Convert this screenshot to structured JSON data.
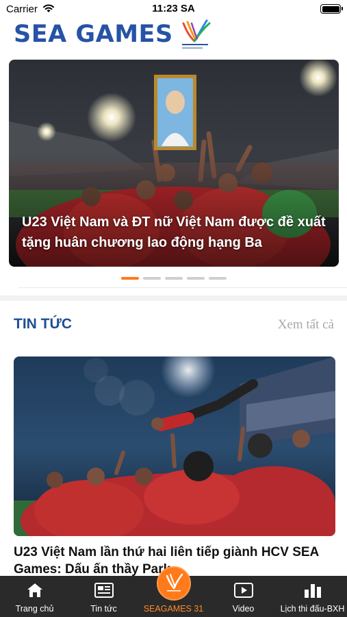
{
  "status_bar": {
    "carrier": "Carrier",
    "time": "11:23 SA",
    "wifi_icon": "wifi-icon",
    "battery_icon": "battery-icon"
  },
  "header": {
    "logo_text": "SEA GAMES",
    "logo_mark_icon": "sea-games-31-emblem-icon"
  },
  "hero": {
    "title": "U23 Việt Nam và ĐT nữ Việt Nam được đề xuất tặng huân chương lao động hạng Ba",
    "slides_total": 5,
    "active_slide": 1
  },
  "news_section": {
    "title": "TIN TỨC",
    "see_all": "Xem tất cả"
  },
  "news_items": [
    {
      "title": "U23 Việt Nam lần thứ hai liên tiếp giành HCV SEA Games: Dấu ấn thầy Park"
    }
  ],
  "tab_bar": {
    "items": [
      {
        "label": "Trang chủ",
        "icon": "home-icon"
      },
      {
        "label": "Tin tức",
        "icon": "newspaper-icon"
      },
      {
        "label": "SEAGAMES 31",
        "icon": "sea-games-badge-icon"
      },
      {
        "label": "Video",
        "icon": "play-icon"
      },
      {
        "label": "Lịch thi đấu-BXH",
        "icon": "bar-chart-icon"
      }
    ]
  },
  "colors": {
    "brand_blue": "#2753a6",
    "section_blue": "#1e4e94",
    "accent_orange": "#ff7a1a",
    "tab_bar_bg": "#2a2a2a"
  }
}
